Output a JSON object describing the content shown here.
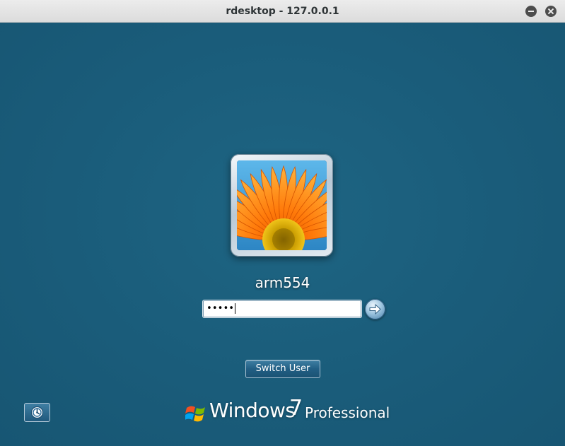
{
  "window": {
    "title": "rdesktop - 127.0.0.1",
    "buttons": [
      "minimize-icon",
      "close-icon"
    ]
  },
  "logon": {
    "user_tile_icon": "orange-flower-picture",
    "username": "arm554",
    "password_value": "•••••",
    "submit_icon": "arrow-right-icon",
    "switch_user_label": "Switch User",
    "ease_of_access_icon": "ease-of-access-icon"
  },
  "branding": {
    "logo_icon": "windows-flag-icon",
    "product": "Windows",
    "version": "7",
    "edition": "Professional"
  },
  "colors": {
    "background": "#1a5c7a",
    "titlebar": "#e4e4e4",
    "button": "#225f84"
  }
}
